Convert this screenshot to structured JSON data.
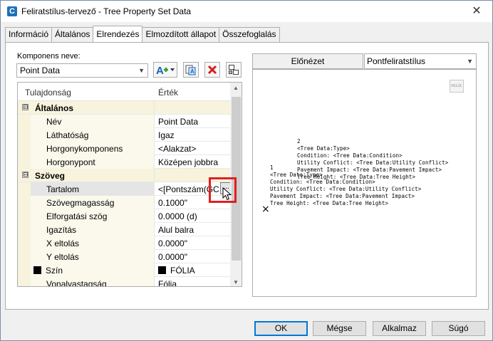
{
  "window": {
    "title": "Feliratstílus-tervező - Tree Property Set Data",
    "app_icon_letter": "C",
    "close_glyph": "✕"
  },
  "tabs": [
    {
      "label": "Információ",
      "active": false
    },
    {
      "label": "Általános",
      "active": false
    },
    {
      "label": "Elrendezés",
      "active": true
    },
    {
      "label": "Elmozdított állapot",
      "active": false
    },
    {
      "label": "Összefoglalás",
      "active": false
    }
  ],
  "component": {
    "label": "Komponens neve:",
    "selected": "Point Data",
    "toolbar": [
      "add-component-icon",
      "copy-component-icon",
      "delete-icon",
      "draw-order-icon"
    ]
  },
  "grid": {
    "headers": {
      "property": "Tulajdonság",
      "value": "Érték"
    },
    "rows": [
      {
        "type": "category",
        "toggle": "⊟",
        "name": "Általános",
        "value": ""
      },
      {
        "type": "prop",
        "name": "Név",
        "value": "Point Data"
      },
      {
        "type": "prop",
        "name": "Láthatóság",
        "value": "Igaz"
      },
      {
        "type": "prop",
        "name": "Horgonykomponens",
        "value": "<Alakzat>"
      },
      {
        "type": "prop",
        "name": "Horgonypont",
        "value": "Középen jobbra"
      },
      {
        "type": "category",
        "toggle": "⊟",
        "name": "Szöveg",
        "value": ""
      },
      {
        "type": "prop",
        "name": "Tartalom",
        "value": "<[Pontszám(GC",
        "selected": true
      },
      {
        "type": "prop",
        "name": "Szövegmagasság",
        "value": "0.1000\""
      },
      {
        "type": "prop",
        "name": "Elforgatási szög",
        "value": "0.0000 (d)"
      },
      {
        "type": "prop",
        "name": "Igazítás",
        "value": "Alul balra"
      },
      {
        "type": "prop",
        "name": "X eltolás",
        "value": "0.0000\""
      },
      {
        "type": "prop",
        "name": "Y eltolás",
        "value": "0.0000\""
      },
      {
        "type": "prop",
        "name": "Szín",
        "value": "FÓLIA",
        "swatch": "#000000"
      },
      {
        "type": "prop",
        "name": "Vonalvastagság",
        "value": "Fólia"
      }
    ],
    "ellipsis_label": "..."
  },
  "preview": {
    "tab_label": "Előnézet",
    "style_selected": "Pontfeliratstílus",
    "north_label": "FELÜL",
    "text_lines": [
      "2",
      "<Tree Data:Type>",
      "Condition: <Tree Data:Condition>",
      "Utility Conflict: <Tree Data:Utility Conflict>",
      "Pavement Impact: <Tree Data:Pavement Impact>",
      "Tree Height: <Tree Data:Tree Height>",
      "1",
      "<Tree Data:Type>",
      "Condition: <Tree Data:Condition>",
      "Utility Conflict: <Tree Data:Utility Conflict>",
      "Pavement Impact: <Tree Data:Pavement Impact>",
      "Tree Height: <Tree Data:Tree Height>"
    ],
    "marker_glyph": "×"
  },
  "footer": {
    "ok": "OK",
    "cancel": "Mégse",
    "apply": "Alkalmaz",
    "help": "Súgó"
  }
}
